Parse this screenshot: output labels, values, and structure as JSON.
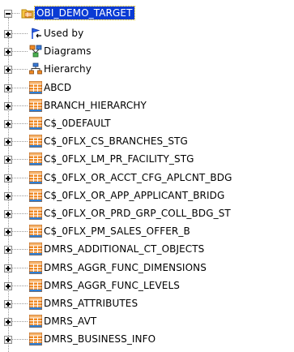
{
  "root": {
    "label": "OBI_DEMO_TARGET",
    "icon": "database-folder-icon",
    "expanded": true,
    "selected": true
  },
  "children": [
    {
      "label": "Used by",
      "icon": "used-by-icon"
    },
    {
      "label": "Diagrams",
      "icon": "diagrams-icon"
    },
    {
      "label": "Hierarchy",
      "icon": "hierarchy-icon"
    },
    {
      "label": "ABCD",
      "icon": "table-icon"
    },
    {
      "label": "BRANCH_HIERARCHY",
      "icon": "table-icon"
    },
    {
      "label": "C$_0DEFAULT",
      "icon": "table-icon"
    },
    {
      "label": "C$_0FLX_CS_BRANCHES_STG",
      "icon": "table-icon"
    },
    {
      "label": "C$_0FLX_LM_PR_FACILITY_STG",
      "icon": "table-icon"
    },
    {
      "label": "C$_0FLX_OR_ACCT_CFG_APLCNT_BDG",
      "icon": "table-icon"
    },
    {
      "label": "C$_0FLX_OR_APP_APPLICANT_BRIDG",
      "icon": "table-icon"
    },
    {
      "label": "C$_0FLX_OR_PRD_GRP_COLL_BDG_ST",
      "icon": "table-icon"
    },
    {
      "label": "C$_0FLX_PM_SALES_OFFER_B",
      "icon": "table-icon"
    },
    {
      "label": "DMRS_ADDITIONAL_CT_OBJECTS",
      "icon": "table-icon"
    },
    {
      "label": "DMRS_AGGR_FUNC_DIMENSIONS",
      "icon": "table-icon"
    },
    {
      "label": "DMRS_AGGR_FUNC_LEVELS",
      "icon": "table-icon"
    },
    {
      "label": "DMRS_ATTRIBUTES",
      "icon": "table-icon"
    },
    {
      "label": "DMRS_AVT",
      "icon": "table-icon"
    },
    {
      "label": "DMRS_BUSINESS_INFO",
      "icon": "table-icon"
    }
  ],
  "colors": {
    "selection": "#0a3bd4",
    "selection_text": "#ffffff",
    "table_icon_orange": "#f08a24",
    "table_icon_blue": "#2d7fd6",
    "guide_line": "#9a9a9a"
  }
}
